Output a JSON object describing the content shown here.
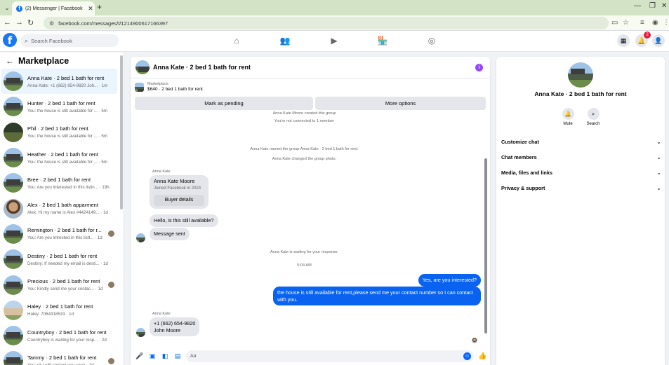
{
  "browser": {
    "tab_title": "(2) Messenger | Facebook",
    "url": "facebook.com/messages/t/1214900617166397"
  },
  "fbnav": {
    "search_placeholder": "Search Facebook",
    "notif_count": "2"
  },
  "left": {
    "title": "Marketplace",
    "conversations": [
      {
        "name": "Anna Kate · 2 bed 1 bath for rent",
        "preview": "Anna Kate: +1 (662) 654-9820 Joh... · 1m",
        "avatar": "house"
      },
      {
        "name": "Hunter · 2 bed 1 bath for rent",
        "preview": "You: the house is still available for ... · 5m",
        "avatar": "house"
      },
      {
        "name": "Phil · 2 bed 1 bath for rent",
        "preview": "You: the house is still available for ... · 5m",
        "avatar": "dark"
      },
      {
        "name": "Heather · 2 bed 1 bath for rent",
        "preview": "You: the house is still available for ... · 5m",
        "avatar": "house"
      },
      {
        "name": "Bree · 2 bed 1 bath for rent",
        "preview": "You: Are you interested in this listin... · 19h",
        "avatar": "house"
      },
      {
        "name": "Alex · 2 bed 1 bath apparment",
        "preview": "Alex: Hi my name is Alex #4424149... · 1d",
        "avatar": "face"
      },
      {
        "name": "Remington · 2 bed 1 bath for r...",
        "preview": "You: Are you intrested in this listt... · 1d",
        "avatar": "house"
      },
      {
        "name": "Destiny · 2 bed 1 bath for rent",
        "preview": "Destiny: If needed my email is desti... · 1d",
        "avatar": "house"
      },
      {
        "name": "Precious · 2 bed 1 bath for rent",
        "preview": "You: Kindly send me your contac... · 1d",
        "avatar": "house"
      },
      {
        "name": "Haley · 2 bed 1 bath for rent",
        "preview": "Haley: 7064318533 · 1d",
        "avatar": "house2"
      },
      {
        "name": "Countryboy · 2 bed 1 bath for rent",
        "preview": "Countryboy is waiting for your resp... · 2d",
        "avatar": "house"
      },
      {
        "name": "Tammy · 2 bed 1 bath for rent",
        "preview": "You: ok i will contact you soon · 2d",
        "avatar": "house"
      }
    ]
  },
  "chat": {
    "title": "Anna Kate · 2 bed 1 bath for rent",
    "marketplace_label": "Marketplace",
    "listing": "$640 · 2 bed 1 bath for rent",
    "mark_pending": "Mark as pending",
    "more_options": "More options",
    "sys_created": "Anna Kate Moore created this group",
    "sys_not_connected": "You're not connected to 1 member",
    "sys_named": "Anna Kate named the group Anna Kate · 2 bed 1 bath for rent.",
    "sys_photo": "Anna Kate changed the group photo.",
    "sender_1": "Anna Kate",
    "buyer_name": "Anna Kate Moore",
    "buyer_joined": "Joined Facebook in 2024",
    "buyer_details": "Buyer details",
    "msg_available": "Hello, is this still available?",
    "msg_sent": "Message sent",
    "sys_waiting": "Anna Kate is waiting for your response.",
    "time": "5:04 AM",
    "out_1": "Yes, are you interested?",
    "out_2": "the house is still available for rent,please send me your contact number so I can contact with you.",
    "sender_2": "Anna Kate",
    "in_phone": "+1 (662) 654-9820",
    "in_name": "John Moore",
    "composer_placeholder": "Aa"
  },
  "right": {
    "title": "Anna Kate · 2 bed 1 bath for rent",
    "mute": "Mute",
    "search": "Search",
    "rows": [
      "Customize chat",
      "Chat members",
      "Media, files and links",
      "Privacy & support"
    ]
  }
}
